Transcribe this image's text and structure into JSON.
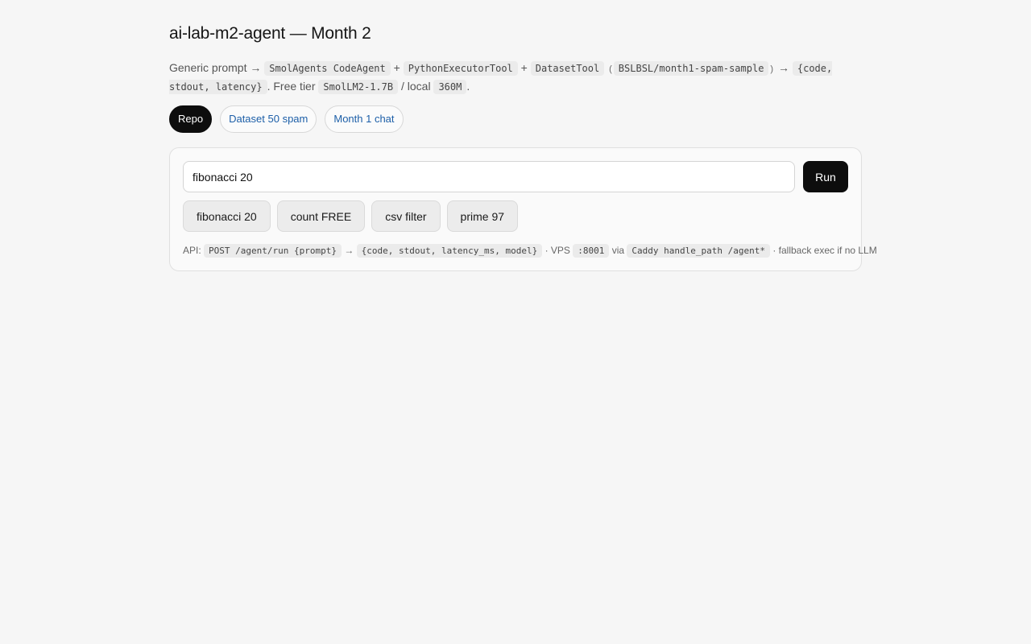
{
  "title": "ai-lab-m2-agent — Month 2",
  "description": {
    "t1": "Generic prompt",
    "arrow": "→",
    "c1": "SmolAgents CodeAgent",
    "plus": "+",
    "c2": "PythonExecutorTool",
    "c3": "DatasetTool",
    "lparen": "(",
    "c4": "BSLBSL/month1-spam-sample",
    "rparen": ")",
    "c5": "{code, stdout, latency}",
    "t2": ". Free tier",
    "c6": "SmolLM2-1.7B",
    "t3": "/ local",
    "c7": "360M",
    "t4": "."
  },
  "links": [
    {
      "label": "Repo"
    },
    {
      "label": "Dataset 50 spam"
    },
    {
      "label": "Month 1 chat"
    }
  ],
  "prompt": {
    "value": "fibonacci 20",
    "run_label": "Run"
  },
  "examples": [
    {
      "label": "fibonacci 20"
    },
    {
      "label": "count FREE"
    },
    {
      "label": "csv filter"
    },
    {
      "label": "prime 97"
    }
  ],
  "api": {
    "prefix": "API:",
    "c1": "POST /agent/run {prompt}",
    "arrow": "→",
    "c2": "{code, stdout, latency_ms, model}",
    "t1": "· VPS",
    "c3": ":8001",
    "t2": "via",
    "c4": "Caddy handle_path /agent*",
    "t3": "· fallback exec if no LLM"
  },
  "colors": {
    "background": "#f6f6f6",
    "link": "#1d5fa8",
    "primary_button": "#0d0d0d"
  }
}
